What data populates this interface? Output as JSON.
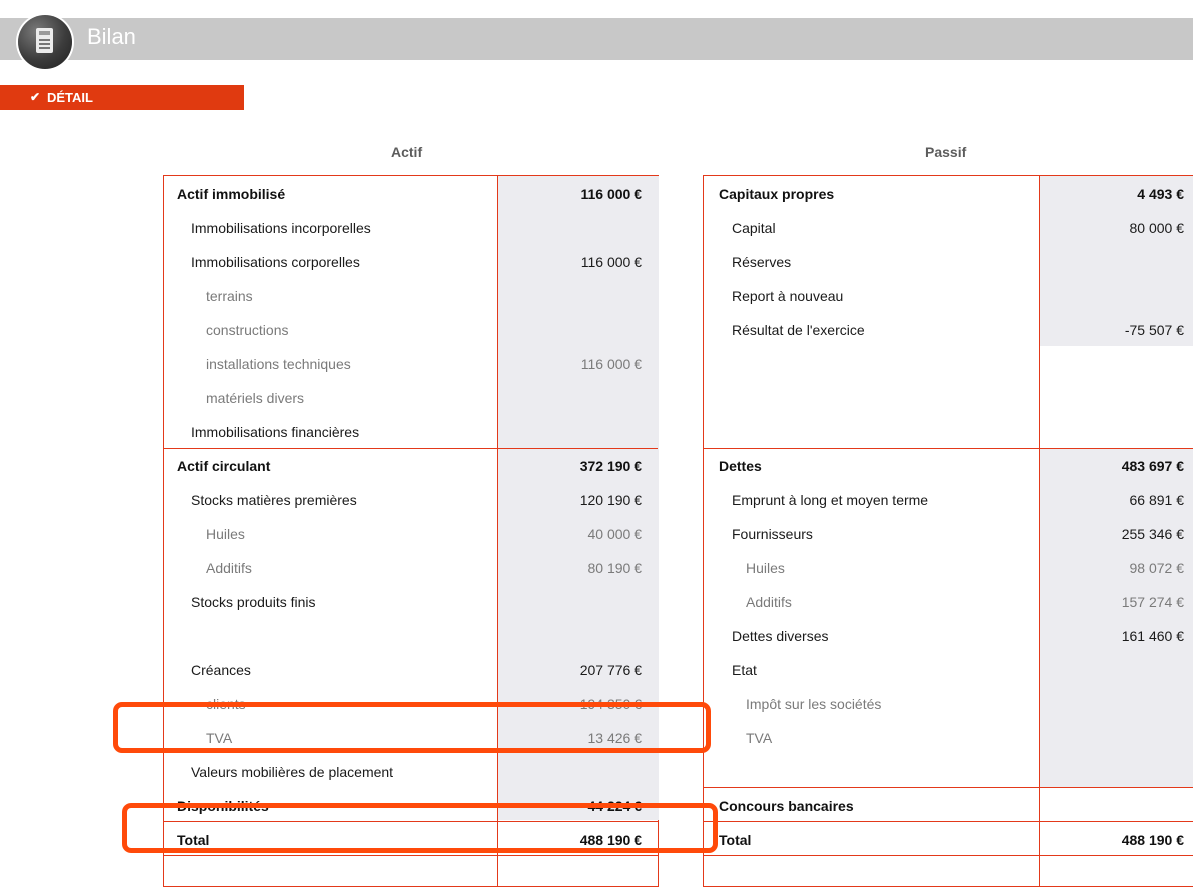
{
  "header": {
    "title": "Bilan",
    "icon": "calculator-icon"
  },
  "tab": {
    "check": "✔",
    "label": "DÉTAIL"
  },
  "colors": {
    "accent": "#e3391a",
    "highlight": "#ff4a0a",
    "topbar": "#c8c8c8",
    "amount_bg": "#ececf0"
  },
  "actif": {
    "heading": "Actif",
    "rows": [
      {
        "label": "Actif immobilisé",
        "value": "116 000 €",
        "level": 0
      },
      {
        "label": "Immobilisations incorporelles",
        "value": "",
        "level": 1
      },
      {
        "label": "Immobilisations corporelles",
        "value": "116 000 €",
        "level": 1
      },
      {
        "label": "terrains",
        "value": "",
        "level": 2
      },
      {
        "label": "constructions",
        "value": "",
        "level": 2
      },
      {
        "label": "installations techniques",
        "value": "116 000 €",
        "level": 2
      },
      {
        "label": "matériels divers",
        "value": "",
        "level": 2
      },
      {
        "label": "Immobilisations financières",
        "value": "",
        "level": 1
      },
      {
        "label": "Actif circulant",
        "value": "372 190 €",
        "level": 0
      },
      {
        "label": "Stocks matières premières",
        "value": "120 190 €",
        "level": 1
      },
      {
        "label": "Huiles",
        "value": "40 000 €",
        "level": 2
      },
      {
        "label": "Additifs",
        "value": "80 190 €",
        "level": 2
      },
      {
        "label": "Stocks produits finis",
        "value": "",
        "level": 1
      },
      {
        "label": "",
        "value": "",
        "level": 1
      },
      {
        "label": "Créances",
        "value": "207 776 €",
        "level": 1
      },
      {
        "label": "clients",
        "value": "194 350 €",
        "level": 2
      },
      {
        "label": "TVA",
        "value": "13 426 €",
        "level": 2
      },
      {
        "label": "Valeurs mobilières de placement",
        "value": "",
        "level": 1
      },
      {
        "label": "Disponibilités",
        "value": "44 224 €",
        "level": 0
      },
      {
        "label": "Total",
        "value": "488 190 €",
        "level": 0
      }
    ]
  },
  "passif": {
    "heading": "Passif",
    "rows": [
      {
        "label": "Capitaux propres",
        "value": "4 493 €",
        "level": 0
      },
      {
        "label": "Capital",
        "value": "80 000 €",
        "level": 1
      },
      {
        "label": "Réserves",
        "value": "",
        "level": 1
      },
      {
        "label": "Report à nouveau",
        "value": "",
        "level": 1
      },
      {
        "label": "Résultat de l'exercice",
        "value": "-75 507 €",
        "level": 1
      },
      {
        "label": "",
        "value": "",
        "level": 1
      },
      {
        "label": "",
        "value": "",
        "level": 1
      },
      {
        "label": "",
        "value": "",
        "level": 1
      },
      {
        "label": "Dettes",
        "value": "483 697 €",
        "level": 0
      },
      {
        "label": "Emprunt à long et moyen terme",
        "value": "66 891 €",
        "level": 1
      },
      {
        "label": "Fournisseurs",
        "value": "255 346 €",
        "level": 1
      },
      {
        "label": "Huiles",
        "value": "98 072 €",
        "level": 2
      },
      {
        "label": "Additifs",
        "value": "157 274 €",
        "level": 2
      },
      {
        "label": "Dettes diverses",
        "value": "161 460 €",
        "level": 1
      },
      {
        "label": "Etat",
        "value": "",
        "level": 1
      },
      {
        "label": "Impôt sur les sociétés",
        "value": "",
        "level": 2
      },
      {
        "label": "TVA",
        "value": "",
        "level": 2
      },
      {
        "label": "",
        "value": "",
        "level": 1
      },
      {
        "label": "Concours bancaires",
        "value": "",
        "level": 0
      },
      {
        "label": "Total",
        "value": "488 190 €",
        "level": 0
      }
    ]
  }
}
